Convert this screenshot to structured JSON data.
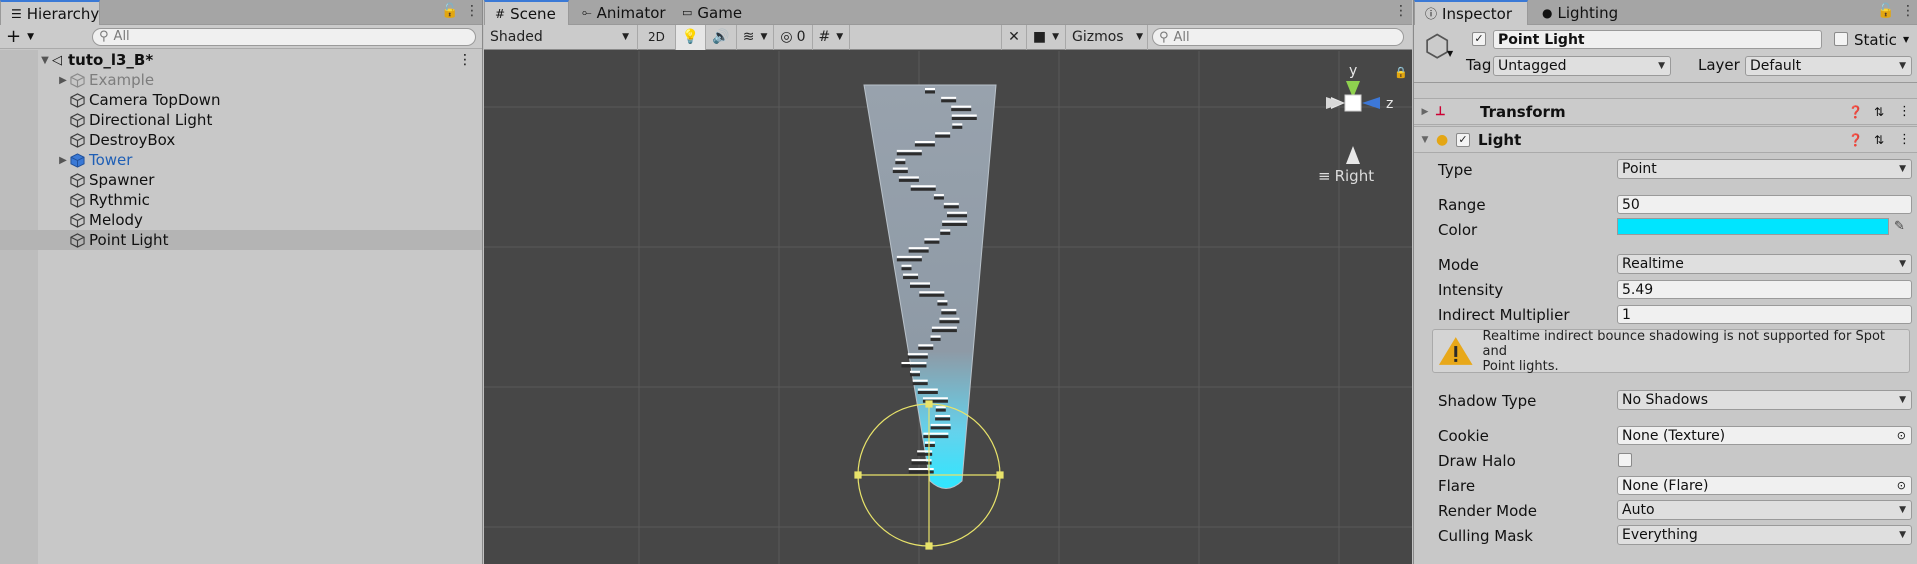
{
  "hierarchy": {
    "tab_label": "Hierarchy",
    "search_placeholder": "All",
    "scene_name": "tuto_l3_B*",
    "items": [
      {
        "label": "Example",
        "icon": "cube-outline-icon",
        "expandable": true,
        "disabled": true
      },
      {
        "label": "Camera TopDown",
        "icon": "cube-outline-icon",
        "expandable": false
      },
      {
        "label": "Directional Light",
        "icon": "cube-outline-icon",
        "expandable": false
      },
      {
        "label": "DestroyBox",
        "icon": "cube-outline-icon",
        "expandable": false
      },
      {
        "label": "Tower",
        "icon": "prefab-cube-icon",
        "expandable": true,
        "prefab": true
      },
      {
        "label": "Spawner",
        "icon": "cube-outline-icon",
        "expandable": false
      },
      {
        "label": "Rythmic",
        "icon": "cube-outline-icon",
        "expandable": false
      },
      {
        "label": "Melody",
        "icon": "cube-outline-icon",
        "expandable": false
      },
      {
        "label": "Point Light",
        "icon": "cube-outline-icon",
        "expandable": false,
        "selected": true
      }
    ]
  },
  "scene": {
    "tabs": [
      {
        "label": "Scene",
        "icon": "grid-icon",
        "active": true
      },
      {
        "label": "Animator",
        "icon": "animator-icon"
      },
      {
        "label": "Game",
        "icon": "gamepad-icon"
      }
    ],
    "draw_mode": "Shaded",
    "mode_2d": "2D",
    "hidden_count": "0",
    "gizmos_label": "Gizmos",
    "search_placeholder": "All",
    "orientation_label": "Right",
    "gizmo_axes": {
      "y": "y",
      "z": "z"
    }
  },
  "inspector": {
    "tabs": [
      {
        "label": "Inspector",
        "icon": "info-icon",
        "active": true
      },
      {
        "label": "Lighting",
        "icon": "bulb-icon"
      }
    ],
    "object_name": "Point Light",
    "active": true,
    "static_label": "Static",
    "tag_label": "Tag",
    "tag_value": "Untagged",
    "layer_label": "Layer",
    "layer_value": "Default",
    "components": {
      "transform": {
        "label": "Transform"
      },
      "light": {
        "label": "Light",
        "enabled": true
      }
    },
    "light": {
      "type_label": "Type",
      "type_value": "Point",
      "range_label": "Range",
      "range_value": "50",
      "color_label": "Color",
      "color_value": "#00e5ff",
      "mode_label": "Mode",
      "mode_value": "Realtime",
      "intensity_label": "Intensity",
      "intensity_value": "5.49",
      "indirect_label": "Indirect Multiplier",
      "indirect_value": "1",
      "warning_line1": "Realtime indirect bounce shadowing is not supported for Spot and",
      "warning_line2": "Point lights.",
      "shadow_label": "Shadow Type",
      "shadow_value": "No Shadows",
      "cookie_label": "Cookie",
      "cookie_value": "None (Texture)",
      "halo_label": "Draw Halo",
      "flare_label": "Flare",
      "flare_value": "None (Flare)",
      "render_label": "Render Mode",
      "render_value": "Auto",
      "culling_label": "Culling Mask",
      "culling_value": "Everything"
    }
  },
  "colors": {
    "accent": "#3a79d6",
    "light_color": "#00e5ff",
    "prefab_text": "#1f5fb5",
    "warning": "#e8a81a",
    "gizmo_y": "#8fd14f",
    "gizmo_z": "#3d78d8",
    "selection_yellow": "#e8e36a"
  }
}
